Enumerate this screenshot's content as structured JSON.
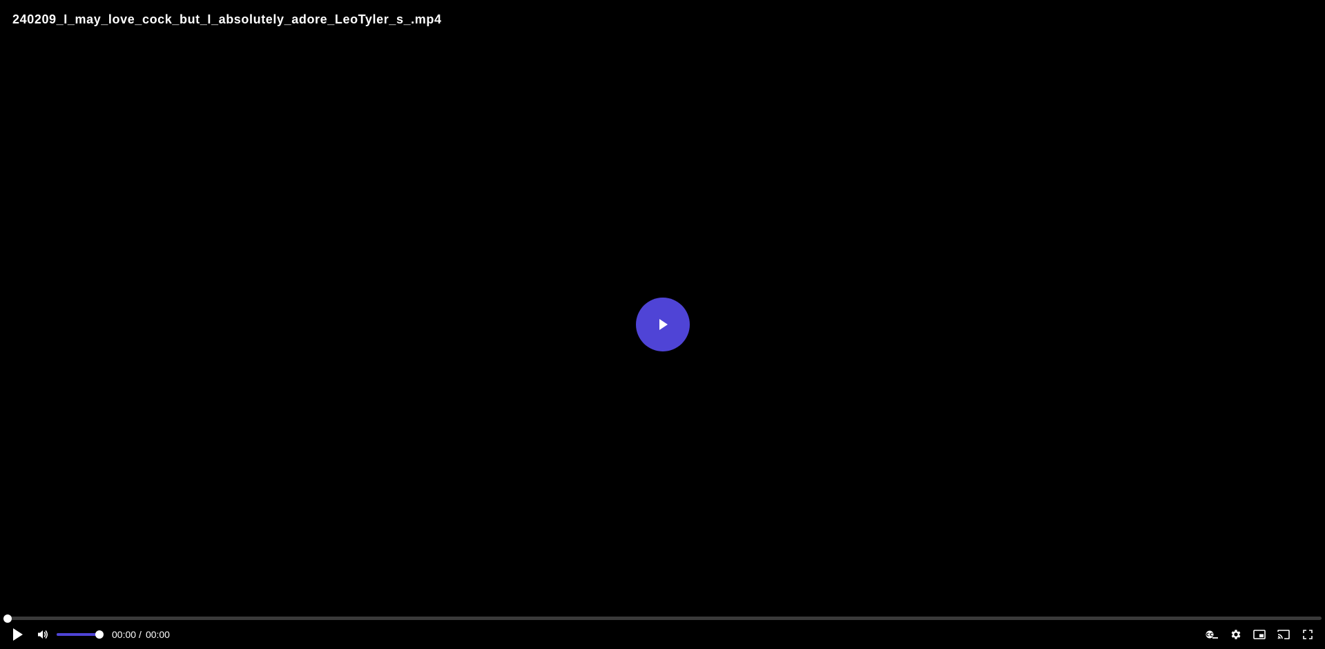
{
  "video": {
    "title": "240209_I_may_love_cock_but_I_absolutely_adore_LeoTyler_s_.mp4"
  },
  "playback": {
    "current_time": "00:00",
    "separator": "/",
    "duration": "00:00",
    "progress_fraction": 0,
    "volume_fraction": 1
  },
  "icons": {
    "big_play": "play-icon",
    "play": "play-icon",
    "volume": "volume-icon",
    "captions": "captions-icon",
    "settings": "gear-icon",
    "pip": "picture-in-picture-icon",
    "cast": "cast-icon",
    "fullscreen": "fullscreen-icon"
  },
  "colors": {
    "accent": "#4f44d6",
    "background": "#000000",
    "track": "#3a3a3a"
  }
}
